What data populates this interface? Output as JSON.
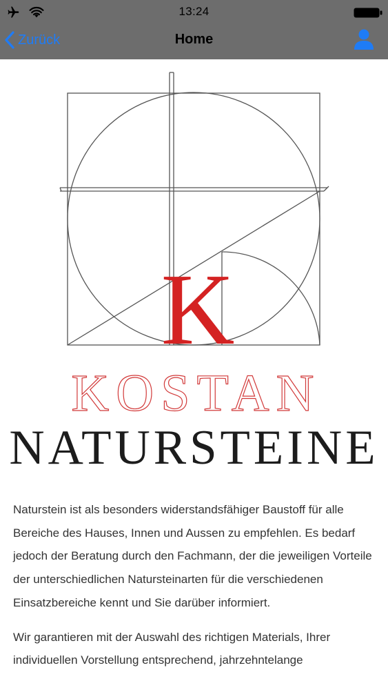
{
  "status_bar": {
    "time": "13:24",
    "icons": [
      "airplane-icon",
      "wifi-icon",
      "battery-icon"
    ]
  },
  "nav_bar": {
    "back_label": "Zurück",
    "title": "Home",
    "right_icon": "user-icon"
  },
  "logo": {
    "monogram": "K",
    "brand_line1": "KOSTAN",
    "brand_line2": "NATURSTEINE"
  },
  "content": {
    "paragraph1": "Naturstein ist als besonders widerstandsfähiger Baustoff für alle Bereiche des Hauses, Innen und Aussen zu empfehlen. Es bedarf jedoch der Beratung durch den Fachmann, der die jeweiligen Vorteile der unterschiedlichen Natursteinarten für die verschiedenen Einsatzbereiche kennt und Sie darüber informiert.",
    "paragraph2": "Wir garantieren mit der Auswahl des richtigen Materials, Ihrer individuellen Vorstellung entsprechend, jahrzehntelange"
  },
  "colors": {
    "topbar": "#6d6d6d",
    "ios_blue": "#1f7cf6",
    "logo_red": "#d42222",
    "logo_line": "#555555"
  }
}
